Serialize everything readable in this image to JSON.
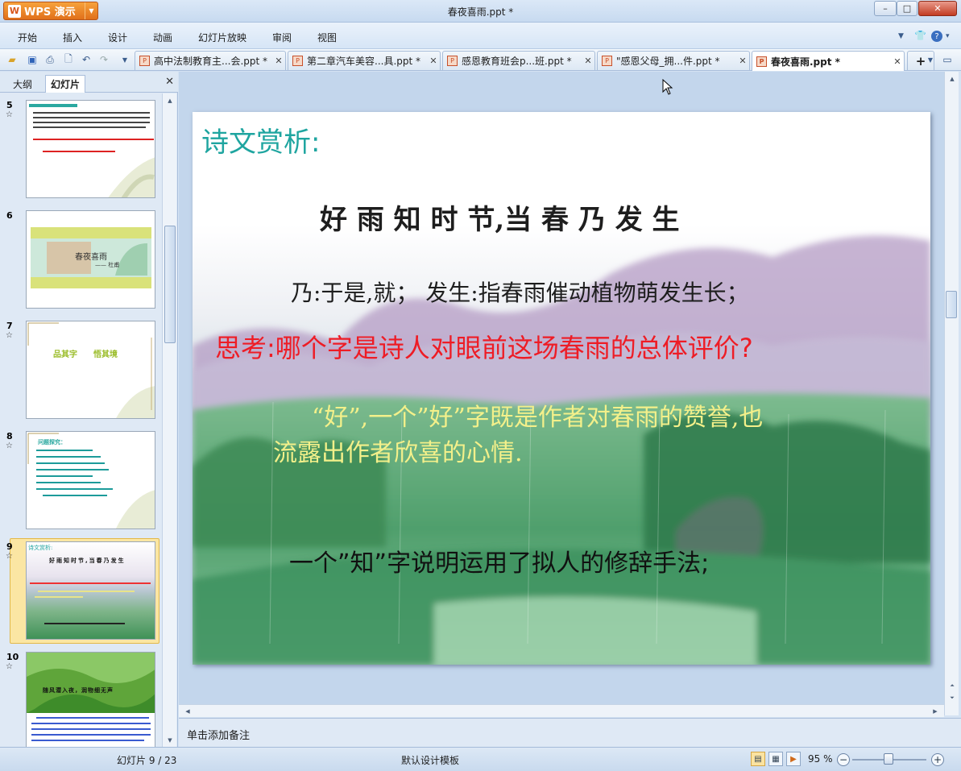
{
  "app": {
    "name": "WPS 演示",
    "logo_letter": "W",
    "window_title": "春夜喜雨.ppt *"
  },
  "window_controls": {
    "minimize_glyph": "–",
    "maximize_glyph": "□",
    "close_glyph": "✕"
  },
  "menu": {
    "items": [
      "开始",
      "插入",
      "设计",
      "动画",
      "幻灯片放映",
      "审阅",
      "视图"
    ],
    "right_icons": [
      "chevron-down-icon",
      "skin-icon",
      "help-icon"
    ]
  },
  "toolbar": {
    "quick_icons": [
      "open-icon",
      "save-icon",
      "print-icon",
      "print-preview-icon",
      "undo-icon",
      "redo-icon",
      "customize-icon"
    ],
    "tabs": [
      {
        "label": "高中法制教育主...会.ppt *",
        "active": false
      },
      {
        "label": "第二章汽车美容...具.ppt *",
        "active": false
      },
      {
        "label": "感恩教育班会p...班.ppt *",
        "active": false
      },
      {
        "label": "\"感恩父母_拥...件.ppt *",
        "active": false
      },
      {
        "label": "春夜喜雨.ppt *",
        "active": true
      }
    ],
    "new_tab_glyph": "+"
  },
  "left_panel": {
    "tab_outline": "大纲",
    "tab_slides": "幻灯片",
    "close_glyph": "✕",
    "thumbnails": [
      {
        "num": "5",
        "selected": false
      },
      {
        "num": "6",
        "selected": false,
        "title": "春夜喜雨",
        "author": "—— 杜甫"
      },
      {
        "num": "7",
        "selected": false,
        "text_a": "品其字",
        "text_b": "悟其境"
      },
      {
        "num": "8",
        "selected": false,
        "heading": "问题探究："
      },
      {
        "num": "9",
        "selected": true,
        "heading": "诗文赏析:",
        "title": "好雨知时节,当春乃发生"
      },
      {
        "num": "10",
        "selected": false,
        "title": "随风潜入夜，润物细无声"
      }
    ],
    "star_glyph": "☆"
  },
  "slide": {
    "heading": "诗文赏析:",
    "title_line": "好 雨 知 时 节,当 春 乃 发 生",
    "gloss_line": "乃:于是,就；  发生:指春雨催动植物萌发生长；",
    "question_line": "思考:哪个字是诗人对眼前这场春雨的总体评价?",
    "answer_line1": "“好”,一个”好”字既是作者对春雨的赞誉,也",
    "answer_line2": "流露出作者欣喜的心情.",
    "bottom_line": "一个”知”字说明运用了拟人的修辞手法;",
    "colors": {
      "heading": "#1fa5a0",
      "question": "#ee1c25",
      "answer": "#f3f08a",
      "body": "#111111"
    }
  },
  "notes": {
    "placeholder": "单击添加备注"
  },
  "status": {
    "slide_counter": "幻灯片 9 / 23",
    "template": "默认设计模板",
    "zoom": "95 %",
    "zoom_minus": "−",
    "zoom_plus": "+"
  }
}
